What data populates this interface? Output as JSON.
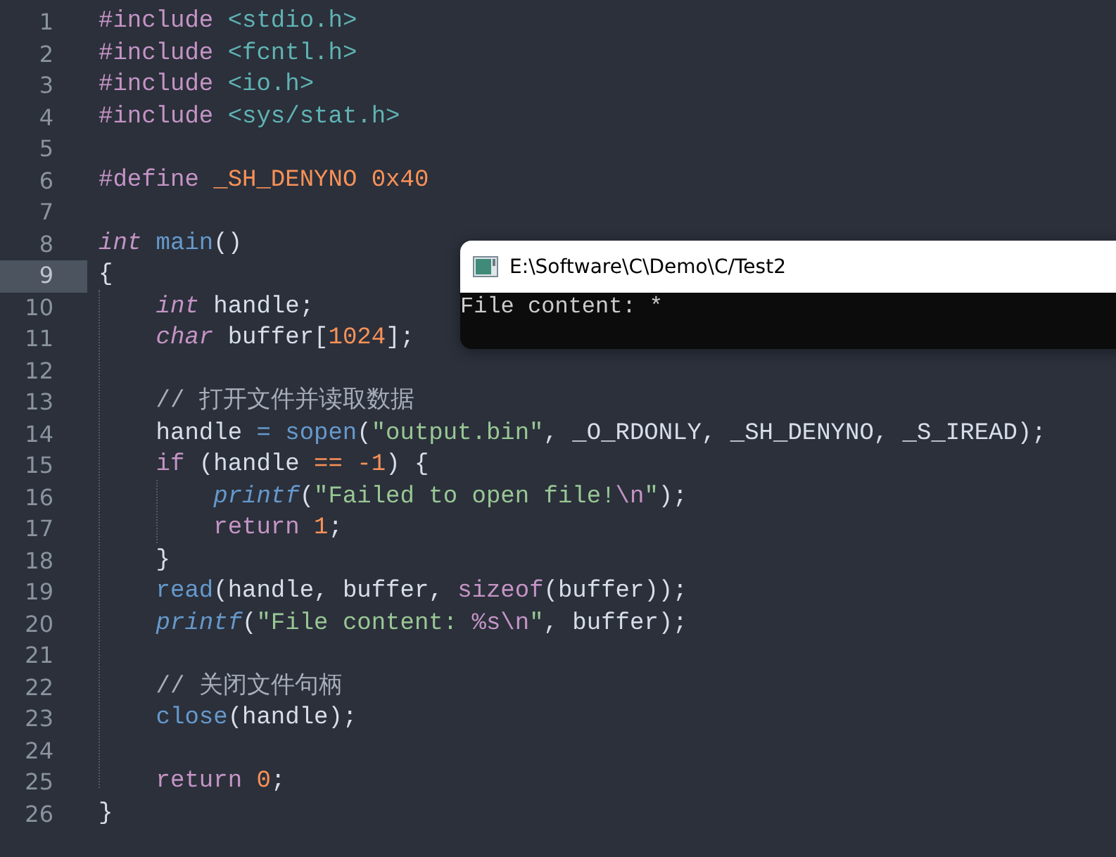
{
  "editor": {
    "lines": [
      {
        "number": "1",
        "selected": false,
        "tokens": [
          {
            "text": "#include ",
            "kind": "directive"
          },
          {
            "text": "<stdio.h>",
            "kind": "header"
          }
        ]
      },
      {
        "number": "2",
        "selected": false,
        "tokens": [
          {
            "text": "#include ",
            "kind": "directive"
          },
          {
            "text": "<fcntl.h>",
            "kind": "header"
          }
        ]
      },
      {
        "number": "3",
        "selected": false,
        "tokens": [
          {
            "text": "#include ",
            "kind": "directive"
          },
          {
            "text": "<io.h>",
            "kind": "header"
          }
        ]
      },
      {
        "number": "4",
        "selected": false,
        "tokens": [
          {
            "text": "#include ",
            "kind": "directive"
          },
          {
            "text": "<sys/stat.h>",
            "kind": "header"
          }
        ]
      },
      {
        "number": "5",
        "selected": false
      },
      {
        "number": "6",
        "selected": false,
        "tokens": [
          {
            "text": "#define ",
            "kind": "directive"
          },
          {
            "text": "_SH_DENYNO 0x40",
            "kind": "macro"
          }
        ]
      },
      {
        "number": "7",
        "selected": false
      },
      {
        "number": "8",
        "selected": false,
        "tokens": [
          {
            "text": "int",
            "kind": "type"
          },
          {
            "text": " main",
            "kind": "func"
          },
          {
            "text": "()",
            "kind": "plain"
          }
        ]
      },
      {
        "number": "9",
        "selected": true,
        "tokens": [
          {
            "text": "{",
            "kind": "plain"
          }
        ]
      },
      {
        "number": "10",
        "selected": false,
        "tokens": [
          {
            "text": "    int",
            "kind": "type"
          },
          {
            "text": " handle;",
            "kind": "plain"
          }
        ]
      },
      {
        "number": "11",
        "selected": false,
        "tokens": [
          {
            "text": "    char",
            "kind": "type"
          },
          {
            "text": " buffer[",
            "kind": "plain"
          },
          {
            "text": "1024",
            "kind": "number"
          },
          {
            "text": "];",
            "kind": "plain"
          }
        ]
      },
      {
        "number": "12",
        "selected": false
      },
      {
        "number": "13",
        "selected": false,
        "tokens": [
          {
            "text": "    // 打开文件并读取数据",
            "kind": "comment"
          }
        ]
      },
      {
        "number": "14",
        "selected": false,
        "tokens": [
          {
            "text": "    handle ",
            "kind": "plain"
          },
          {
            "text": "=",
            "kind": "assign"
          },
          {
            "text": " sopen",
            "kind": "func"
          },
          {
            "text": "(",
            "kind": "plain"
          },
          {
            "text": "\"output.bin\"",
            "kind": "string"
          },
          {
            "text": ", _O_RDONLY, _SH_DENYNO, _S_IREAD);",
            "kind": "plain"
          }
        ]
      },
      {
        "number": "15",
        "selected": false,
        "tokens": [
          {
            "text": "    if",
            "kind": "keyword"
          },
          {
            "text": " (handle ",
            "kind": "plain"
          },
          {
            "text": "==",
            "kind": "operator"
          },
          {
            "text": " -1",
            "kind": "number"
          },
          {
            "text": ") {",
            "kind": "plain"
          }
        ]
      },
      {
        "number": "16",
        "selected": false,
        "tokens": [
          {
            "text": "        printf",
            "kind": "builtin"
          },
          {
            "text": "(",
            "kind": "plain"
          },
          {
            "text": "\"Failed to open file!",
            "kind": "string"
          },
          {
            "text": "\\n",
            "kind": "escape"
          },
          {
            "text": "\"",
            "kind": "string"
          },
          {
            "text": ");",
            "kind": "plain"
          }
        ]
      },
      {
        "number": "17",
        "selected": false,
        "tokens": [
          {
            "text": "        return",
            "kind": "keyword"
          },
          {
            "text": " 1",
            "kind": "number"
          },
          {
            "text": ";",
            "kind": "plain"
          }
        ]
      },
      {
        "number": "18",
        "selected": false,
        "tokens": [
          {
            "text": "    }",
            "kind": "plain"
          }
        ]
      },
      {
        "number": "19",
        "selected": false,
        "tokens": [
          {
            "text": "    read",
            "kind": "func"
          },
          {
            "text": "(handle, buffer, ",
            "kind": "plain"
          },
          {
            "text": "sizeof",
            "kind": "keyword"
          },
          {
            "text": "(buffer));",
            "kind": "plain"
          }
        ]
      },
      {
        "number": "20",
        "selected": false,
        "tokens": [
          {
            "text": "    printf",
            "kind": "builtin"
          },
          {
            "text": "(",
            "kind": "plain"
          },
          {
            "text": "\"File content: ",
            "kind": "string"
          },
          {
            "text": "%s\\n",
            "kind": "escape"
          },
          {
            "text": "\"",
            "kind": "string"
          },
          {
            "text": ", buffer);",
            "kind": "plain"
          }
        ]
      },
      {
        "number": "21",
        "selected": false
      },
      {
        "number": "22",
        "selected": false,
        "tokens": [
          {
            "text": "    // 关闭文件句柄",
            "kind": "comment"
          }
        ]
      },
      {
        "number": "23",
        "selected": false,
        "tokens": [
          {
            "text": "    close",
            "kind": "func"
          },
          {
            "text": "(handle);",
            "kind": "plain"
          }
        ]
      },
      {
        "number": "24",
        "selected": false
      },
      {
        "number": "25",
        "selected": false,
        "tokens": [
          {
            "text": "    return",
            "kind": "keyword"
          },
          {
            "text": " 0",
            "kind": "number"
          },
          {
            "text": ";",
            "kind": "plain"
          }
        ]
      },
      {
        "number": "26",
        "selected": false,
        "tokens": [
          {
            "text": "}",
            "kind": "plain"
          }
        ]
      }
    ]
  },
  "console": {
    "title": "E:\\Software\\C\\Demo\\C/Test2",
    "output": "File content: *"
  }
}
